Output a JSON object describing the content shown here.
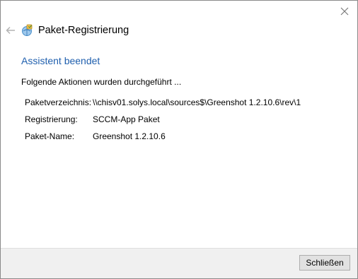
{
  "window": {
    "title": "Paket-Registrierung",
    "close_icon": "close-icon",
    "back_icon": "arrow-left-icon",
    "app_icon": "package-icon"
  },
  "content": {
    "heading": "Assistent beendet",
    "summary": "Folgende Aktionen wurden durchgeführt ...",
    "details": [
      {
        "label": "Paketverzeichnis:",
        "value": "\\\\chisv01.solys.local\\sources$\\Greenshot 1.2.10.6\\rev\\1"
      },
      {
        "label": "Registrierung:",
        "value": "SCCM-App Paket"
      },
      {
        "label": "Paket-Name:",
        "value": "Greenshot 1.2.10.6"
      }
    ]
  },
  "footer": {
    "close_button_label": "Schließen"
  },
  "colors": {
    "accent": "#1f5fae",
    "footer_bg": "#f0f0f0",
    "button_bg": "#e1e1e1",
    "button_border": "#adadad"
  }
}
